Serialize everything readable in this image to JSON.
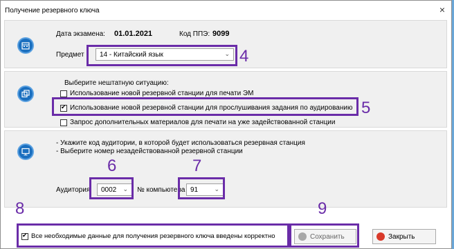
{
  "window": {
    "title": "Получение резервного ключа",
    "close": "×"
  },
  "exam": {
    "date_label": "Дата экзамена:",
    "date_value": "01.01.2021",
    "ppe_label": "Код ППЭ:",
    "ppe_value": "9099",
    "subject_label": "Предмет",
    "subject_value": "14 - Китайский язык"
  },
  "situation": {
    "heading": "Выберите нештатную ситуацию:",
    "options": [
      {
        "label": "Использование новой резервной станции для печати ЭМ",
        "checked": false
      },
      {
        "label": "Использование новой резервной станции для прослушивания задания по аудированию",
        "checked": true
      },
      {
        "label": "Запрос дополнительных материалов для печати на уже задействованной станции",
        "checked": false
      }
    ]
  },
  "station": {
    "hint1": "- Укажите код аудитории, в которой будет использоваться резервная станция",
    "hint2": "- Выберите номер незадействованной резервной станции",
    "room_label": "Аудитория",
    "room_value": "0002",
    "computer_label": "№ компьютера",
    "computer_value": "91"
  },
  "footer": {
    "confirm_label": "Все необходимые данные для получения резервного ключа введены корректно",
    "confirm_checked": true,
    "save_label": "Сохранить",
    "close_label": "Закрыть"
  },
  "annotations": [
    "4",
    "5",
    "6",
    "7",
    "8",
    "9"
  ],
  "colors": {
    "accent": "#6a2ca8",
    "icon": "#1a6fbf",
    "background": "#6aa7d8"
  }
}
